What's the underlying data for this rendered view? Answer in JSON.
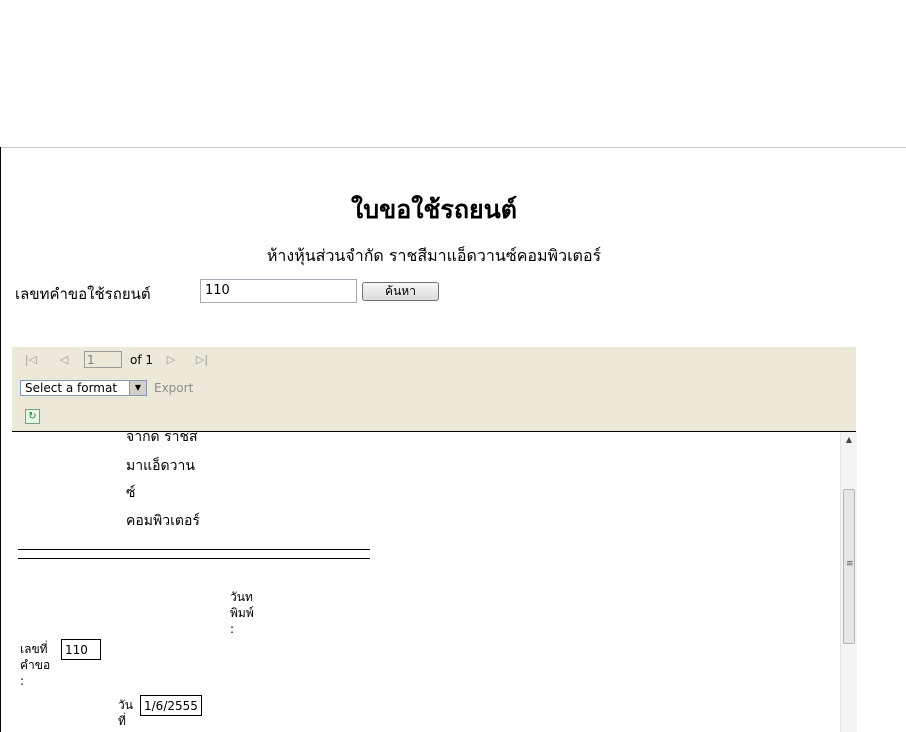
{
  "form": {
    "title": "ใบขอใช้รถยนต์",
    "company": "ห้างหุ้นส่วนจำกัด ราชสีมาแอ็ดวานซ์คอมพิวเตอร์",
    "request_label": "เลขทคำขอใช้รถยนต์",
    "request_value": "110",
    "search_button": "ค้นหา"
  },
  "viewer": {
    "page_current": "1",
    "page_of": "of 1",
    "format_select": "Select a format",
    "export_label": "Export",
    "icons": {
      "first": "first-page-icon",
      "prev": "previous-page-icon",
      "next": "next-page-icon",
      "last": "last-page-icon",
      "refresh": "refresh-icon"
    }
  },
  "report": {
    "company_lines": [
      "จากด ราชส",
      "มาแอ็ดวาน",
      "ซ์",
      "คอมพิวเตอร์"
    ],
    "print_date_label": [
      "วันท",
      "พิมพ์",
      ":"
    ],
    "request_no_label": [
      "เลขที่",
      "คำขอ",
      ":"
    ],
    "request_no_value": "110",
    "date_label": [
      "วัน",
      "ที่"
    ],
    "date_value": "1/6/2555"
  }
}
